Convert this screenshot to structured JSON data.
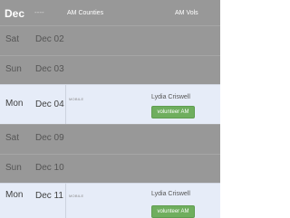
{
  "header": {
    "month": "Dec",
    "dash": "----",
    "counties_label": "AM Counties",
    "vols_label": "AM Vols"
  },
  "rows": [
    {
      "day": "Sat",
      "date": "Dec 02"
    },
    {
      "day": "Sun",
      "date": "Dec 03"
    },
    {
      "day": "Mon",
      "date": "Dec 04",
      "county": "MOBILE",
      "volunteer": "Lydia Criswell",
      "button": "volunteer AM"
    },
    {
      "day": "Sat",
      "date": "Dec 09"
    },
    {
      "day": "Sun",
      "date": "Dec 10"
    },
    {
      "day": "Mon",
      "date": "Dec 11",
      "county": "MOBILE",
      "volunteer": "Lydia Criswell",
      "button": "volunteer AM"
    }
  ],
  "colors": {
    "weekend_bg": "#989898",
    "weekday_bg": "#e6ecf8",
    "button_bg": "#6fae5e"
  }
}
